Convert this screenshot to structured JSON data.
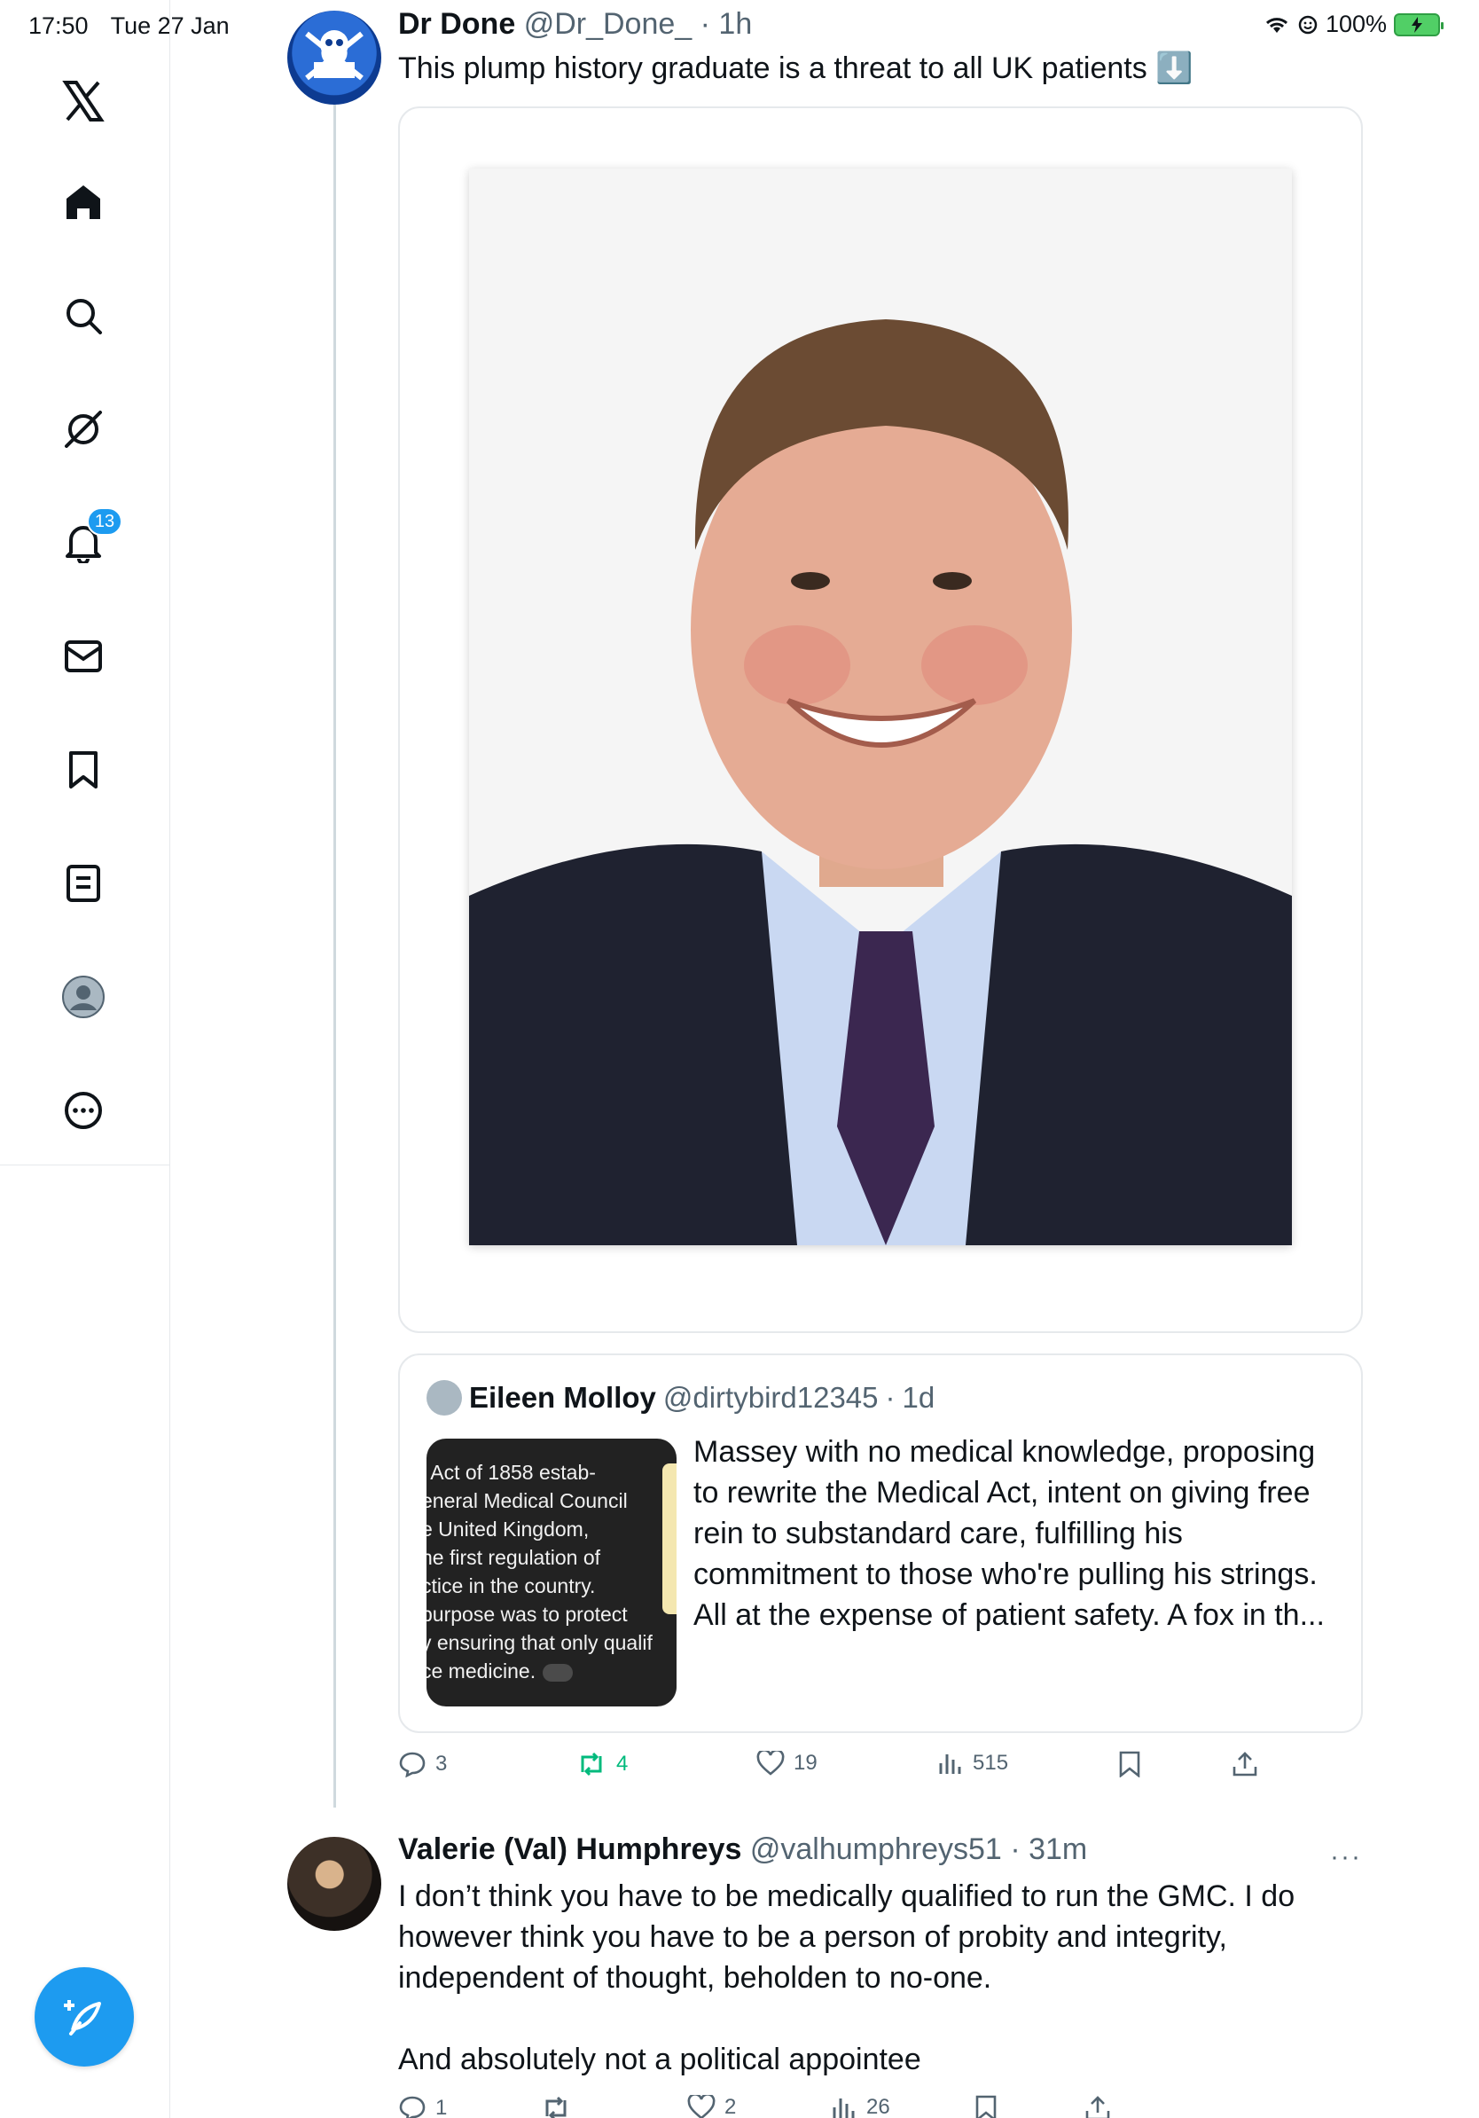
{
  "status_bar": {
    "time": "17:50",
    "date": "Tue 27 Jan",
    "battery": "100%"
  },
  "sidebar": {
    "items": [
      {
        "name": "x-logo"
      },
      {
        "name": "home"
      },
      {
        "name": "search"
      },
      {
        "name": "grok"
      },
      {
        "name": "notifications",
        "badge": "13"
      },
      {
        "name": "messages"
      },
      {
        "name": "bookmarks"
      },
      {
        "name": "lists"
      },
      {
        "name": "profile"
      },
      {
        "name": "more"
      }
    ],
    "compose_icon": "compose-quill-icon"
  },
  "main_tweet": {
    "author": "Dr Done",
    "handle": "@Dr_Done_",
    "time": "1h",
    "text": "This plump history graduate is a threat to all UK patients ⬇️",
    "quote": {
      "author": "Eileen Molloy",
      "handle": "@dirtybird12345",
      "time": "1d",
      "thumb_lines": [
        "l Act of 1858 estab-",
        "eneral Medical Council",
        "e United Kingdom,",
        "he first regulation of",
        "ctice in the country.",
        "purpose was to protect",
        "y ensuring that only qualif",
        "ce medicine."
      ],
      "text": "Massey with no medical knowledge, proposing to rewrite the Medical Act, intent on giving free rein to substandard care, fulfilling his commitment to those who're pulling his strings. All at the expense of patient safety. A fox in th..."
    },
    "actions": {
      "replies": "3",
      "reposts": "4",
      "likes": "19",
      "views": "515"
    }
  },
  "reply_tweet": {
    "author": "Valerie (Val) Humphreys",
    "handle": "@valhumphreys51",
    "time": "31m",
    "text_lines": [
      "I don’t think you have to be medically qualified to run the GMC. I do",
      "however think you have to be a person of probity and integrity,",
      "independent of thought, beholden to no-one.",
      "",
      "And absolutely not a political appointee"
    ],
    "actions": {
      "replies": "1",
      "reposts": "",
      "likes": "2",
      "views": "26"
    }
  },
  "colors": {
    "accent": "#1d9bf0",
    "repost_green": "#00ba7c",
    "muted": "#536471",
    "border": "#e6e9ec",
    "battery": "#51cf66"
  }
}
